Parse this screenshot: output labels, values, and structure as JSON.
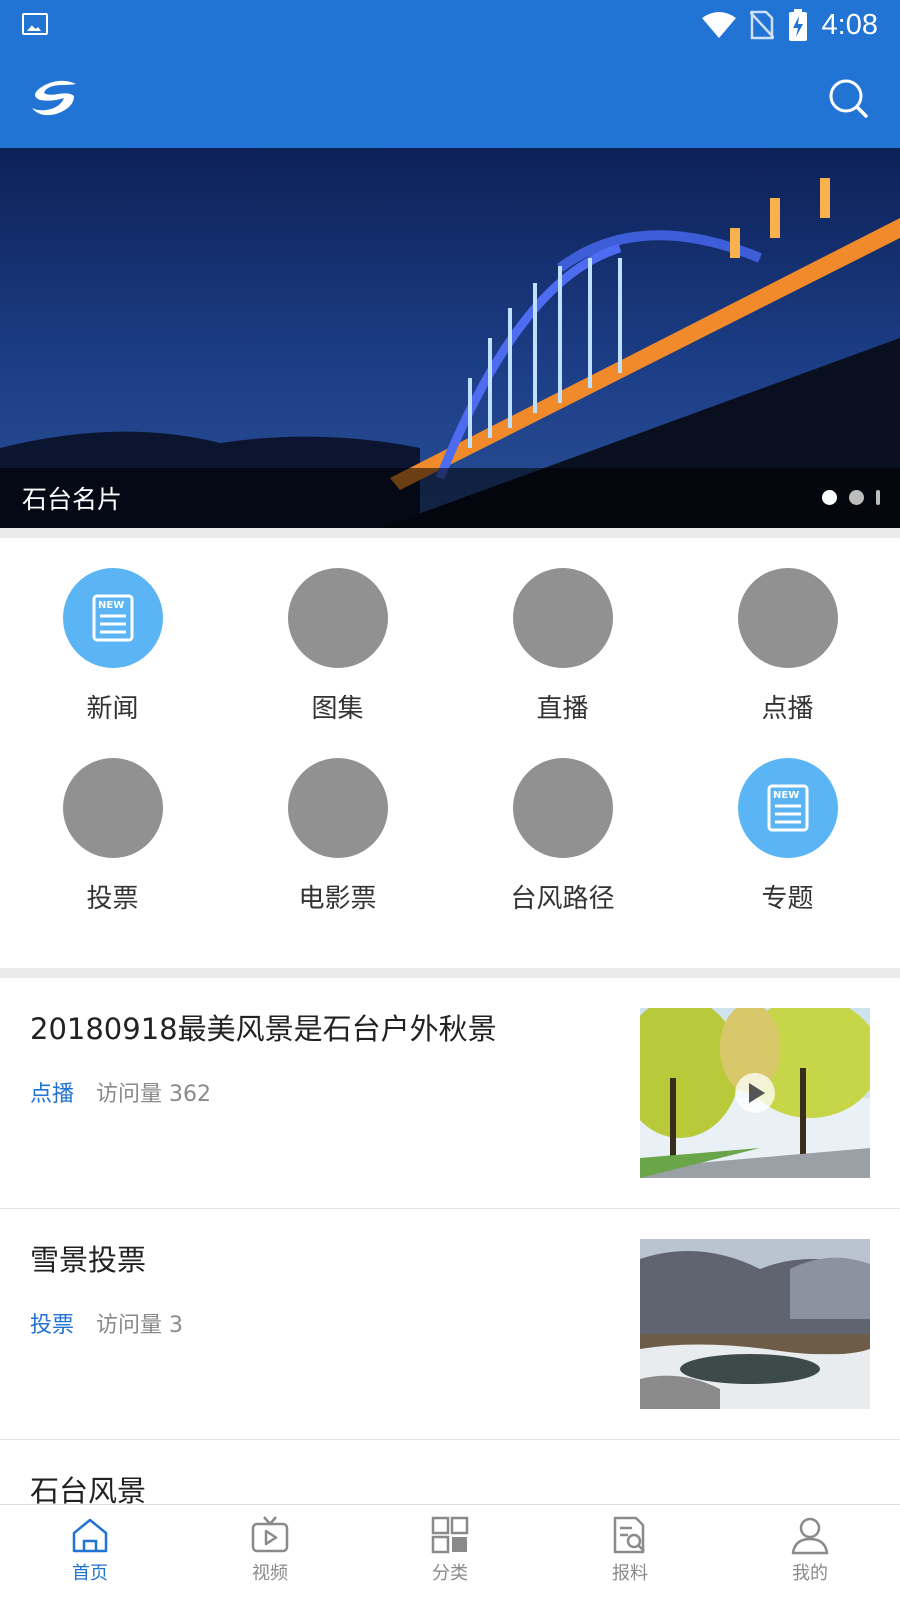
{
  "status_bar": {
    "time": "4:08"
  },
  "banner": {
    "caption": "石台名片",
    "slide_count": 3,
    "active_slide": 1
  },
  "grid": {
    "items": [
      {
        "label": "新闻",
        "icon": "news-icon",
        "color": "#5bb5f4"
      },
      {
        "label": "图集",
        "icon": "placeholder-icon",
        "color": "#919191"
      },
      {
        "label": "直播",
        "icon": "placeholder-icon",
        "color": "#919191"
      },
      {
        "label": "点播",
        "icon": "placeholder-icon",
        "color": "#919191"
      },
      {
        "label": "投票",
        "icon": "placeholder-icon",
        "color": "#919191"
      },
      {
        "label": "电影票",
        "icon": "placeholder-icon",
        "color": "#919191"
      },
      {
        "label": "台风路径",
        "icon": "placeholder-icon",
        "color": "#919191"
      },
      {
        "label": "专题",
        "icon": "news-icon",
        "color": "#5bb5f4"
      }
    ]
  },
  "feed": {
    "items": [
      {
        "title": "20180918最美风景是石台户外秋景",
        "tag": "点播",
        "views": "访问量 362",
        "has_video": true
      },
      {
        "title": "雪景投票",
        "tag": "投票",
        "views": "访问量 3",
        "has_video": false
      },
      {
        "title": "石台风景"
      }
    ]
  },
  "bottom_nav": {
    "items": [
      {
        "label": "首页",
        "icon": "home-icon",
        "active": true
      },
      {
        "label": "视频",
        "icon": "tv-icon",
        "active": false
      },
      {
        "label": "分类",
        "icon": "category-grid-icon",
        "active": false
      },
      {
        "label": "报料",
        "icon": "report-icon",
        "active": false
      },
      {
        "label": "我的",
        "icon": "user-icon",
        "active": false
      }
    ]
  },
  "colors": {
    "primary": "#2173d4",
    "accent_circle": "#5bb5f4",
    "placeholder_circle": "#919191"
  }
}
